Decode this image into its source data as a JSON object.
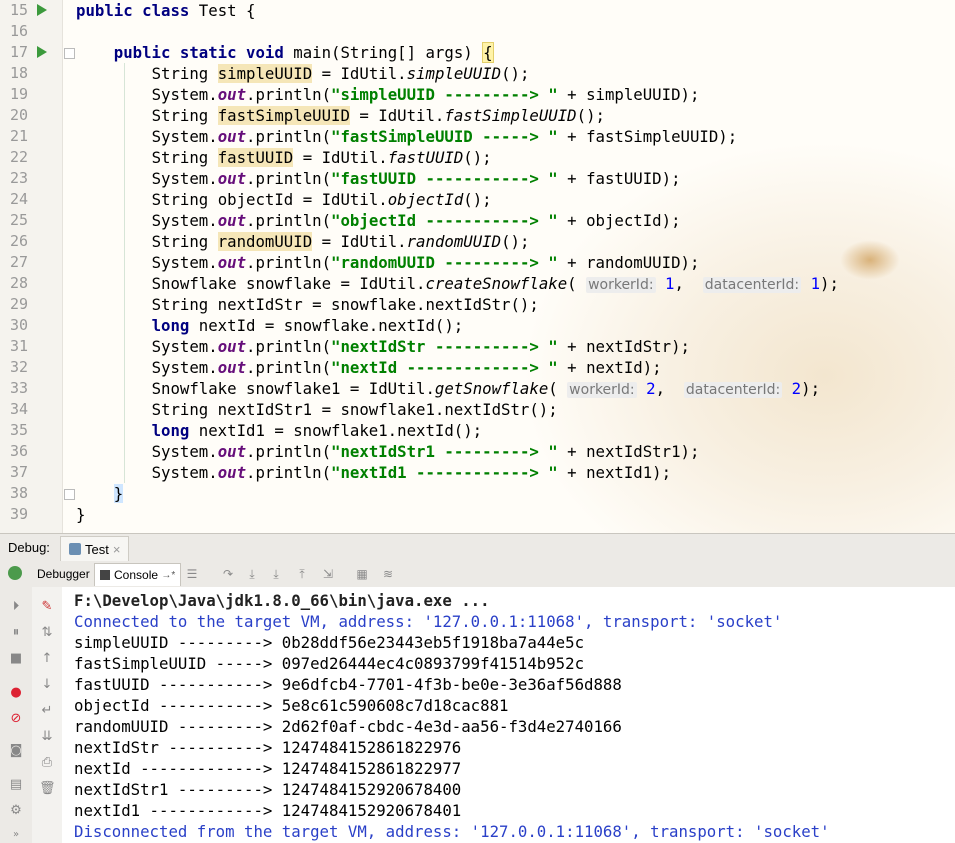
{
  "editor": {
    "lines": [
      {
        "n": "15"
      },
      {
        "n": "16"
      },
      {
        "n": "17"
      },
      {
        "n": "18"
      },
      {
        "n": "19"
      },
      {
        "n": "20"
      },
      {
        "n": "21"
      },
      {
        "n": "22"
      },
      {
        "n": "23"
      },
      {
        "n": "24"
      },
      {
        "n": "25"
      },
      {
        "n": "26"
      },
      {
        "n": "27"
      },
      {
        "n": "28"
      },
      {
        "n": "29"
      },
      {
        "n": "30"
      },
      {
        "n": "31"
      },
      {
        "n": "32"
      },
      {
        "n": "33"
      },
      {
        "n": "34"
      },
      {
        "n": "35"
      },
      {
        "n": "36"
      },
      {
        "n": "37"
      },
      {
        "n": "38"
      },
      {
        "n": "39"
      }
    ],
    "tokens": {
      "public": "public",
      "class": "class",
      "classname": " Test {",
      "static": "static",
      "void": "void",
      "main_sig": " main(String[] args) ",
      "open_brace": "{",
      "string_t": "String ",
      "system": "System.",
      "out": "out",
      "println": ".println(",
      "idutil": "IdUtil.",
      "long": "long",
      "v_simpleUUID": "simpleUUID",
      "m_simpleUUID": "simpleUUID",
      "s_simpleUUID": "\"simpleUUID ---------> \"",
      "c_simpleUUID": " + simpleUUID);",
      "v_fastSimpleUUID": "fastSimpleUUID",
      "m_fastSimpleUUID": "fastSimpleUUID",
      "s_fastSimpleUUID": "\"fastSimpleUUID -----> \"",
      "c_fastSimpleUUID": " + fastSimpleUUID);",
      "v_fastUUID": "fastUUID",
      "m_fastUUID": "fastUUID",
      "s_fastUUID": "\"fastUUID -----------> \"",
      "c_fastUUID": " + fastUUID);",
      "v_objectId": "objectId",
      "m_objectId": "objectId",
      "s_objectId": "\"objectId -----------> \"",
      "c_objectId": " + objectId);",
      "v_randomUUID": "randomUUID",
      "m_randomUUID": "randomUUID",
      "s_randomUUID": "\"randomUUID ---------> \"",
      "c_randomUUID": " + randomUUID);",
      "snowflake_decl": "Snowflake snowflake = ",
      "m_createSnowflake": "createSnowflake",
      "paren_open": "(",
      "hint_worker": "workerId:",
      "hint_datacenter": "datacenterId:",
      "val_1a": "1",
      "val_1b": "1",
      "comma": ", ",
      "close_paren_semi": ");",
      "nextIdStr_decl": "String nextIdStr = snowflake.nextIdStr();",
      "nextId_decl": " nextId = snowflake.nextId();",
      "s_nextIdStr": "\"nextIdStr ----------> \"",
      "c_nextIdStr": " + nextIdStr);",
      "s_nextId": "\"nextId -------------> \"",
      "c_nextId": " + nextId);",
      "snowflake1_decl": "Snowflake snowflake1 = ",
      "m_getSnowflake": "getSnowflake",
      "val_2a": "2",
      "val_2b": "2",
      "nextIdStr1_decl": "String nextIdStr1 = snowflake1.nextIdStr();",
      "nextId1_decl": " nextId1 = snowflake1.nextId();",
      "s_nextIdStr1": "\"nextIdStr1 ---------> \"",
      "c_nextIdStr1": " + nextIdStr1);",
      "s_nextId1": "\"nextId1 ------------> \"",
      "c_nextId1": " + nextId1);",
      "close_brace": "}",
      "call_end": "();"
    }
  },
  "debug": {
    "label": "Debug:",
    "tab_name": "Test",
    "tab_close": "×",
    "debugger_tab": "Debugger",
    "console_tab": "Console",
    "console_arrow": "→*"
  },
  "console": {
    "lines": [
      {
        "text": "F:\\Develop\\Java\\jdk1.8.0_66\\bin\\java.exe ...",
        "style": "cmd"
      },
      {
        "text": "Connected to the target VM, address: '127.0.0.1:11068', transport: 'socket'",
        "style": "blue"
      },
      {
        "text": "simpleUUID ---------> 0b28ddf56e23443eb5f1918ba7a44e5c",
        "style": "plain"
      },
      {
        "text": "fastSimpleUUID -----> 097ed26444ec4c0893799f41514b952c",
        "style": "plain"
      },
      {
        "text": "fastUUID -----------> 9e6dfcb4-7701-4f3b-be0e-3e36af56d888",
        "style": "plain"
      },
      {
        "text": "objectId -----------> 5e8c61c590608c7d18cac881",
        "style": "plain"
      },
      {
        "text": "randomUUID ---------> 2d62f0af-cbdc-4e3d-aa56-f3d4e2740166",
        "style": "plain"
      },
      {
        "text": "nextIdStr ----------> 1247484152861822976",
        "style": "plain"
      },
      {
        "text": "nextId -------------> 1247484152861822977",
        "style": "plain"
      },
      {
        "text": "nextIdStr1 ---------> 1247484152920678400",
        "style": "plain"
      },
      {
        "text": "nextId1 ------------> 1247484152920678401",
        "style": "plain"
      },
      {
        "text": "Disconnected from the target VM, address: '127.0.0.1:11068', transport: 'socket'",
        "style": "blue"
      }
    ]
  },
  "icons": {
    "run": "run-gutter-icon",
    "bug": "debug-bug-icon"
  }
}
